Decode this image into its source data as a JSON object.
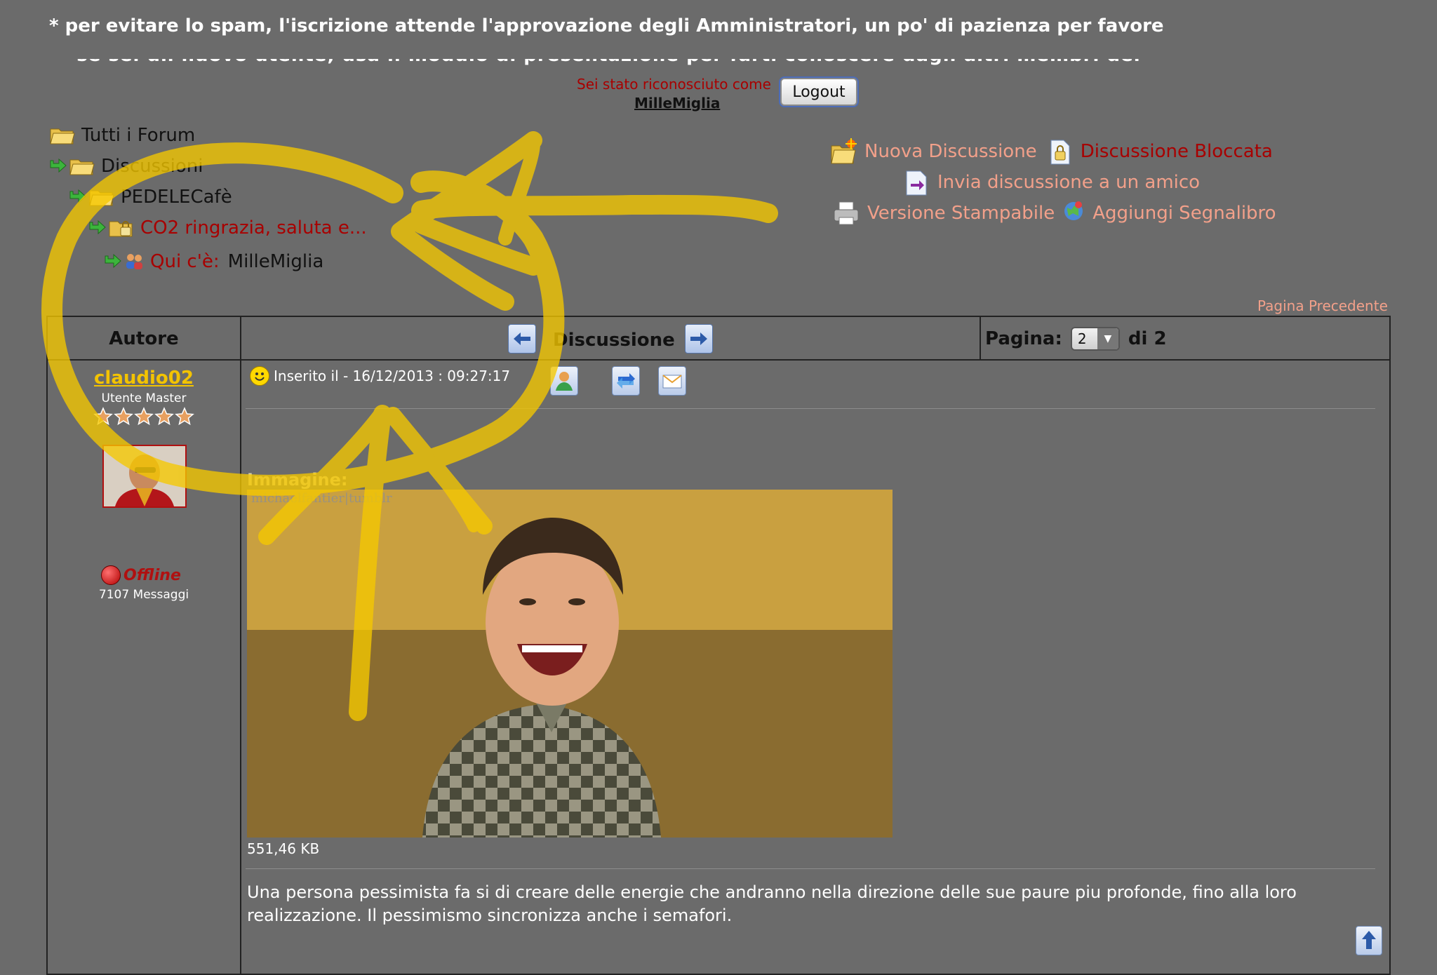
{
  "notice": {
    "line1": "* per evitare lo spam, l'iscrizione attende l'approvazione degli Amministratori, un po' di pazienza per favore",
    "line2": "** se sei un nuovo utente, usa il modulo di presentazione per farti conoscere dagli altri membri del forum"
  },
  "login": {
    "recognized_text": "Sei stato riconosciuto come",
    "username": "MilleMiglia",
    "logout_label": "Logout"
  },
  "breadcrumb": {
    "all_forums": "Tutti i Forum",
    "discussions": "Discussioni",
    "forum": "PEDELECafè",
    "topic": "CO2 ringrazia, saluta e...",
    "here_label": "Qui c'è:",
    "here_user": "MilleMiglia"
  },
  "actions": {
    "new_topic": "Nuova Discussione",
    "locked_topic": "Discussione Bloccata",
    "send_friend": "Invia discussione a un amico",
    "printable": "Versione Stampabile",
    "bookmark": "Aggiungi Segnalibro"
  },
  "pagination": {
    "previous_page": "Pagina Precedente",
    "page_label": "Pagina:",
    "current_page": "2",
    "total_label": "di 2"
  },
  "table_header": {
    "author": "Autore",
    "discussion": "Discussione"
  },
  "author": {
    "name": "claudio02",
    "rank": "Utente Master",
    "status": "Offline",
    "message_count": "7107 Messaggi"
  },
  "post": {
    "posted_on": "Inserito il - 16/12/2013 : 09:27:17",
    "image_label": "Immagine:",
    "image_credit": "michaelfantier|tumblr",
    "file_size": "551,46 KB",
    "text": "Una persona pessimista fa si di creare delle energie che andranno nella direzione delle sue paure piu profonde, fino alla loro realizzazione. Il pessimismo sincronizza anche i semafori."
  },
  "colors": {
    "background": "#6b6b6b",
    "link_salmon": "#f2a08a",
    "dark_red": "#a80000",
    "author_gold": "#f3c300",
    "annotation_yellow": "#f5c800"
  }
}
